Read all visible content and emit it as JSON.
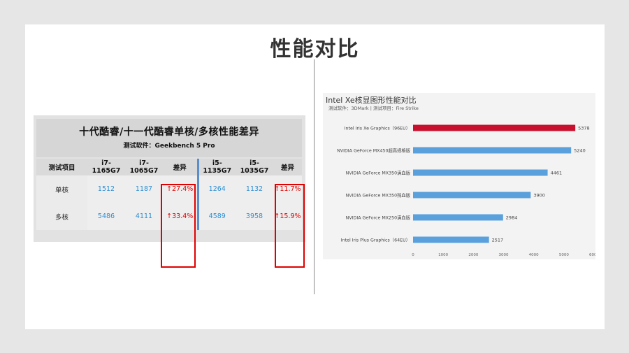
{
  "slide": {
    "title": "性能对比"
  },
  "table": {
    "title": "十代酷睿/十一代酷睿单核/多核性能差异",
    "subtitle": "测试软件：Geekbench 5 Pro",
    "headers": [
      "测试项目",
      "i7-1165G7",
      "i7-1065G7",
      "差异",
      "i5-1135G7",
      "i5-1035G7",
      "差异"
    ],
    "rows": [
      {
        "label": "单核",
        "v1": "1512",
        "v2": "1187",
        "d1": "↑27.4%",
        "v3": "1264",
        "v4": "1132",
        "d2": "↑11.7%"
      },
      {
        "label": "多核",
        "v1": "5486",
        "v2": "4111",
        "d1": "↑33.4%",
        "v3": "4589",
        "v4": "3958",
        "d2": "↑15.9%"
      }
    ],
    "colors": {
      "value": "#2d8fd3",
      "diff": "#e00000",
      "highlight": "#e00000"
    }
  },
  "chart": {
    "title": "Intel Xe核显图形性能对比",
    "subtitle": "测试软件：3DMark | 测试项目：Fire Strike"
  },
  "chart_data": {
    "type": "bar",
    "orientation": "horizontal",
    "title": "Intel Xe核显图形性能对比",
    "categories": [
      "Intel Iris Xe Graphics（96EU）",
      "NVIDIA GeForce MX450超高规格版",
      "NVIDIA GeForce MX350满血版",
      "NVIDIA GeForce MX350残血版",
      "NVIDIA GeForce MX250满血版",
      "Intel Iris Plus Graphics（64EU）"
    ],
    "values": [
      5378,
      5240,
      4461,
      3900,
      2984,
      2517
    ],
    "xlim": [
      0,
      6000
    ],
    "xticks": [
      "0",
      "1000",
      "2000",
      "3000",
      "4000",
      "5000",
      "6000"
    ],
    "grid": false,
    "colors": {
      "highlight": "#c8102e",
      "default": "#5aa0dc"
    }
  }
}
